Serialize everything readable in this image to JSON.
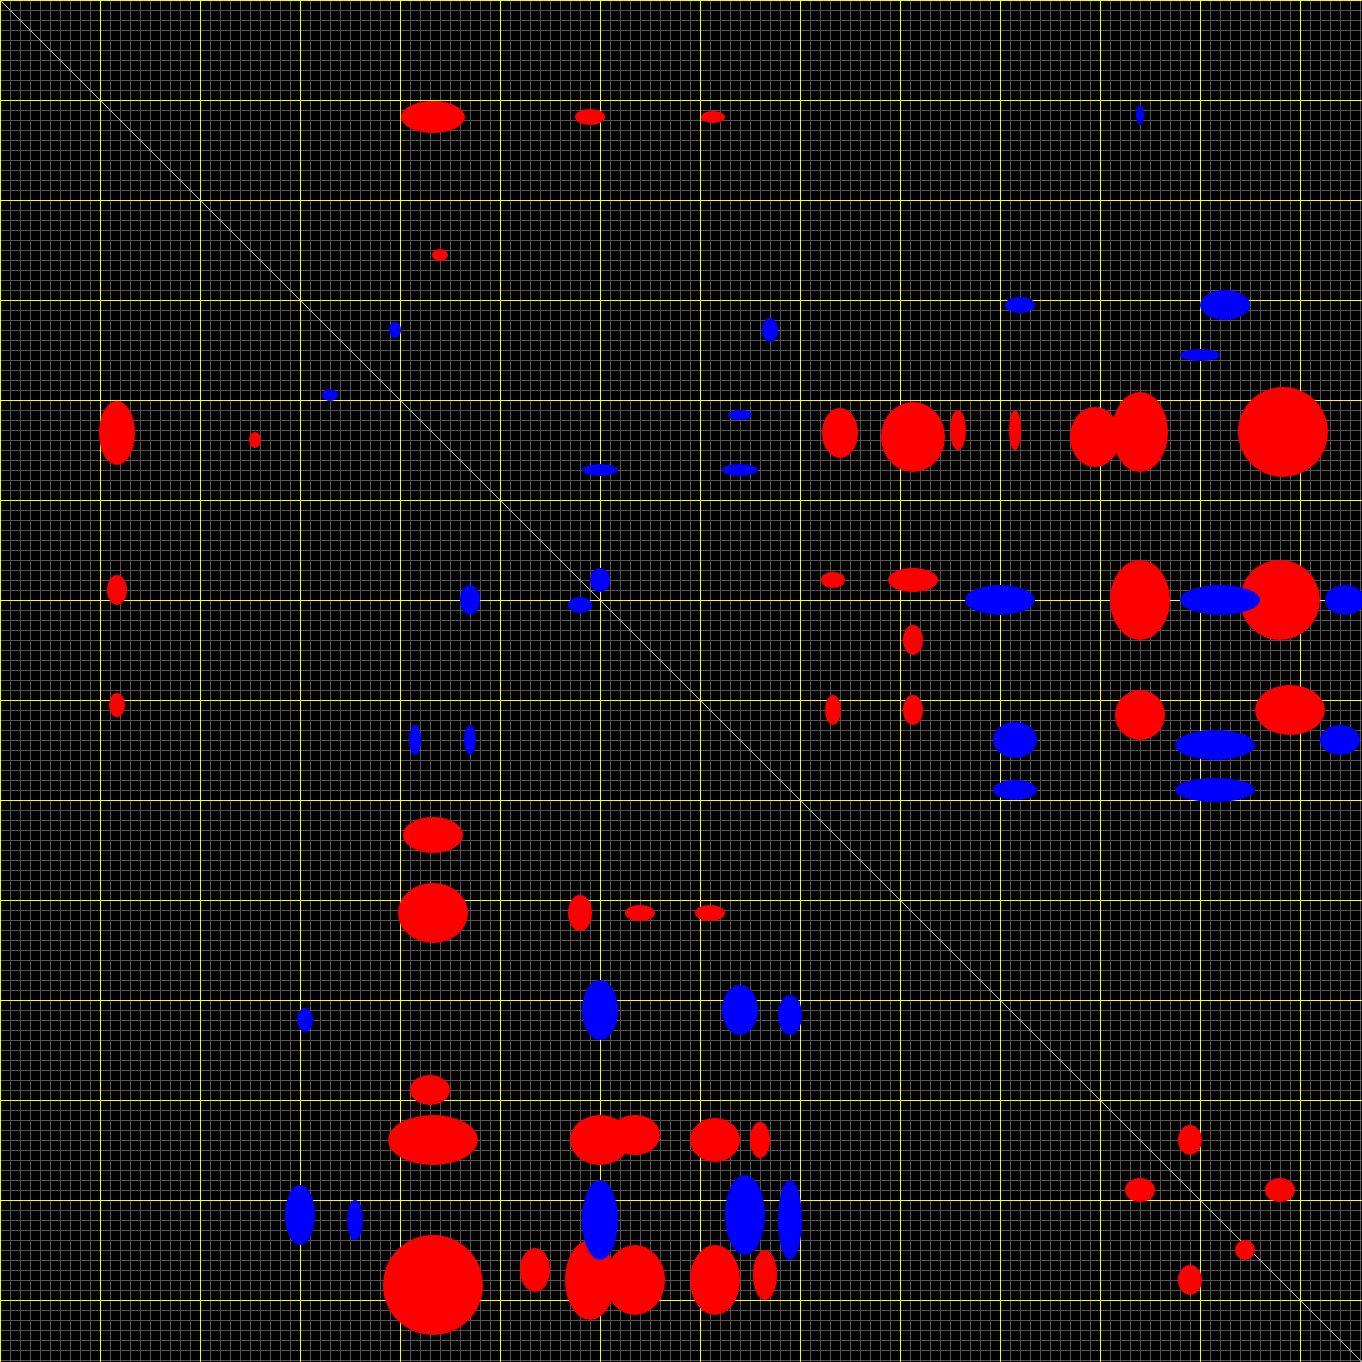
{
  "spectrum_plot": {
    "diagonal": true
  }
}
